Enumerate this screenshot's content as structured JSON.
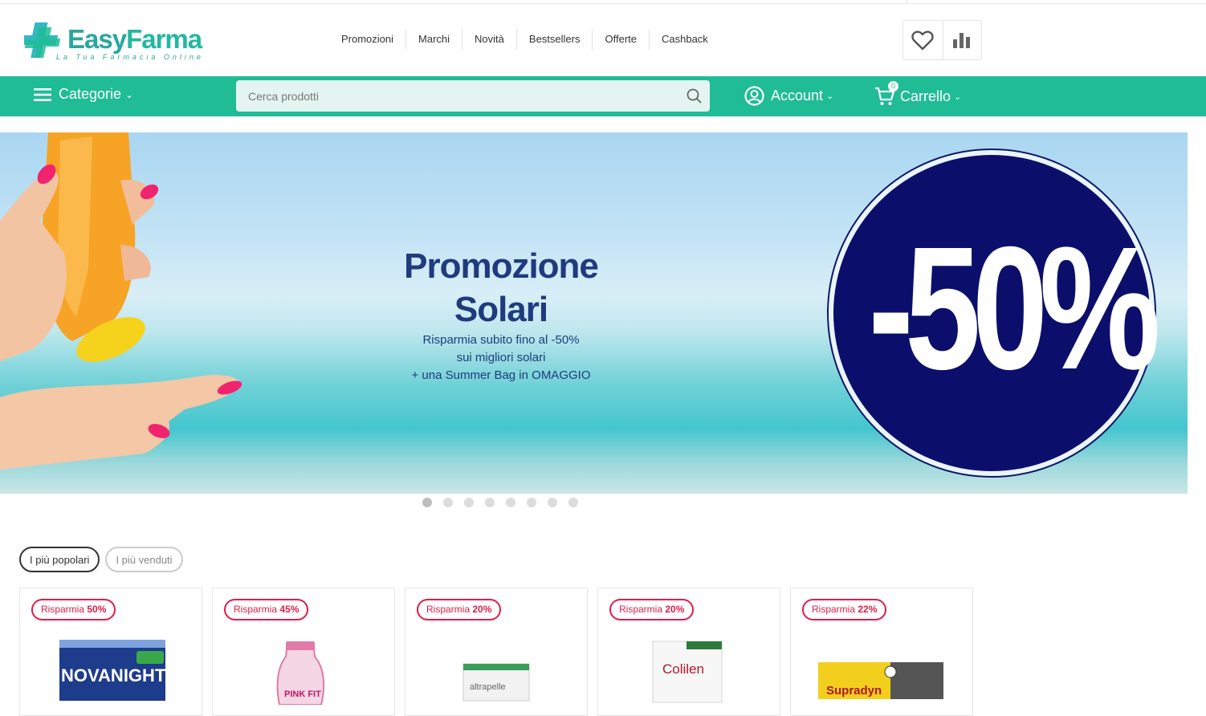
{
  "brand": {
    "name_part1": "Easy",
    "name_part2": "Farma",
    "tagline": "La Tua Farmacia Online"
  },
  "topnav": [
    "Promozioni",
    "Marchi",
    "Novità",
    "Bestsellers",
    "Offerte",
    "Cashback"
  ],
  "header_icons": [
    "heart-icon",
    "chart-icon"
  ],
  "greenbar": {
    "categories_label": "Categorie",
    "search_placeholder": "Cerca prodotti",
    "account_label": "Account",
    "cart_label": "Carrello",
    "cart_count": "0"
  },
  "hero": {
    "title_line1": "Promozione",
    "title_line2": "Solari",
    "sub_line1": "Risparmia subito fino al -50%",
    "sub_line2": "sui migliori solari",
    "sub_line3": "+ una Summer Bag in OMAGGIO",
    "badge": "-50%"
  },
  "slider": {
    "count": 8,
    "active": 1
  },
  "tabs": [
    {
      "label": "I più popolari",
      "active": true
    },
    {
      "label": "I più venduti",
      "active": false
    }
  ],
  "products": [
    {
      "save_prefix": "Risparmia",
      "save_value": "50%",
      "image_label": "NOVANIGHT"
    },
    {
      "save_prefix": "Risparmia",
      "save_value": "45%",
      "image_label": "PINK FIT"
    },
    {
      "save_prefix": "Risparmia",
      "save_value": "20%",
      "image_label": "altrapelle"
    },
    {
      "save_prefix": "Risparmia",
      "save_value": "20%",
      "image_label": "Colilen"
    },
    {
      "save_prefix": "Risparmia",
      "save_value": "22%",
      "image_label": "Supradyn"
    }
  ],
  "colors": {
    "brand_green": "#1fbc96",
    "brand_teal": "#2aa6a1",
    "hero_navy": "#1f3b7d",
    "badge_navy": "#0b0f6b",
    "save_red": "#e11d48"
  }
}
